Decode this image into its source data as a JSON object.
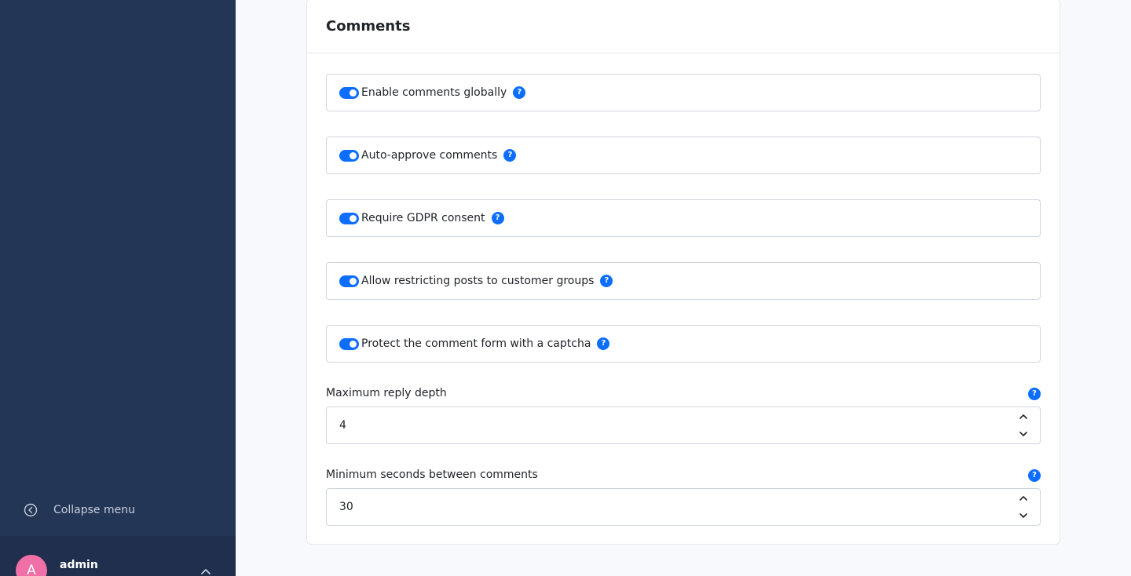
{
  "sidebar": {
    "collapse_label": "Collapse menu",
    "user": {
      "initial": "A",
      "name": "admin"
    }
  },
  "comments": {
    "title": "Comments",
    "toggles": [
      {
        "label": "Enable comments globally",
        "enabled": true
      },
      {
        "label": "Auto-approve comments",
        "enabled": true
      },
      {
        "label": "Require GDPR consent",
        "enabled": true
      },
      {
        "label": "Allow restricting posts to customer groups",
        "enabled": true
      },
      {
        "label": "Protect the comment form with a captcha",
        "enabled": true
      }
    ],
    "fields": [
      {
        "label": "Maximum reply depth",
        "value": "4"
      },
      {
        "label": "Minimum seconds between comments",
        "value": "30"
      }
    ],
    "help_glyph": "?"
  },
  "colors": {
    "sidebar": "#243656",
    "accent": "#0d6efd",
    "avatar": "#f06fa7"
  }
}
